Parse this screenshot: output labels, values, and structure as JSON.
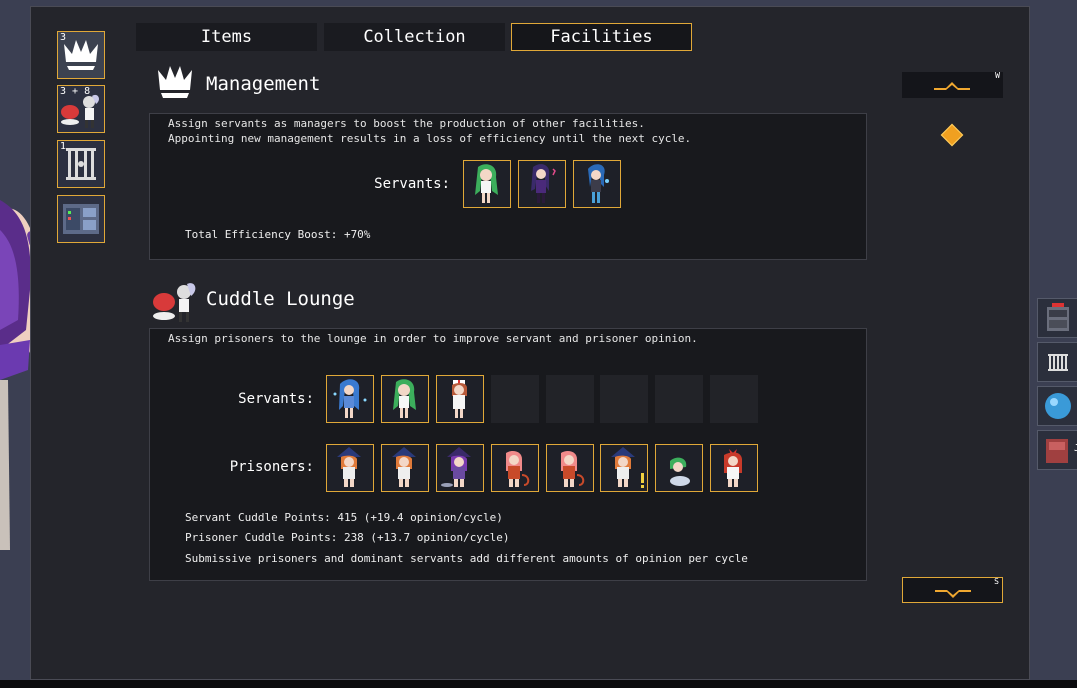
{
  "tabs": [
    {
      "label": "Items",
      "active": false
    },
    {
      "label": "Collection",
      "active": false
    },
    {
      "label": "Facilities",
      "active": true
    }
  ],
  "side_icons": [
    {
      "name": "side-icon-management",
      "count": "3",
      "icon": "crown-icon"
    },
    {
      "name": "side-icon-cuddle-lounge",
      "count": "3 + 8",
      "icon": "cuddle-icon"
    },
    {
      "name": "side-icon-prison",
      "count": "1",
      "icon": "cell-icon"
    },
    {
      "name": "side-icon-machine",
      "count": "",
      "icon": "machine-icon"
    }
  ],
  "management": {
    "title": "Management",
    "desc": "Assign servants as managers to boost the production of other facilities.\nAppointing new management results in a loss of efficiency until the next cycle.",
    "servants_label": "Servants:",
    "servants": [
      "green-hair-servant",
      "purple-hair-servant",
      "blue-hair-servant"
    ],
    "efficiency": "Total Efficiency Boost: +70%"
  },
  "cuddle": {
    "title": "Cuddle Lounge",
    "desc": "Assign prisoners to the lounge in order to improve servant and prisoner opinion.",
    "servants_label": "Servants:",
    "servants": [
      "blue-hair-servant",
      "green-hair-servant",
      "nurse-servant",
      "",
      "",
      "",
      "",
      ""
    ],
    "prisoners_label": "Prisoners:",
    "prisoners": [
      "witch-prisoner",
      "witch-prisoner",
      "purple-witch-prisoner",
      "pink-hair-prisoner",
      "pink-hair-prisoner",
      "witch-prisoner",
      "green-hair-prisoner",
      "red-hair-prisoner"
    ],
    "stats": [
      "Servant Cuddle Points: 415 (+19.4 opinion/cycle)",
      "Prisoner Cuddle Points: 238 (+13.7 opinion/cycle)",
      "Submissive prisoners and dominant servants add different amounts of opinion per cycle"
    ]
  },
  "scroll": {
    "up_key": "W",
    "down_key": "S"
  },
  "right_icons": [
    {
      "name": "right-icon-cabinet",
      "label": ""
    },
    {
      "name": "right-icon-cell",
      "label": ""
    },
    {
      "name": "right-icon-orb",
      "label": ""
    },
    {
      "name": "right-icon-book",
      "label": "J"
    }
  ],
  "colors": {
    "accent": "#e0a838",
    "panel": "#24252b",
    "box": "#18191d"
  }
}
